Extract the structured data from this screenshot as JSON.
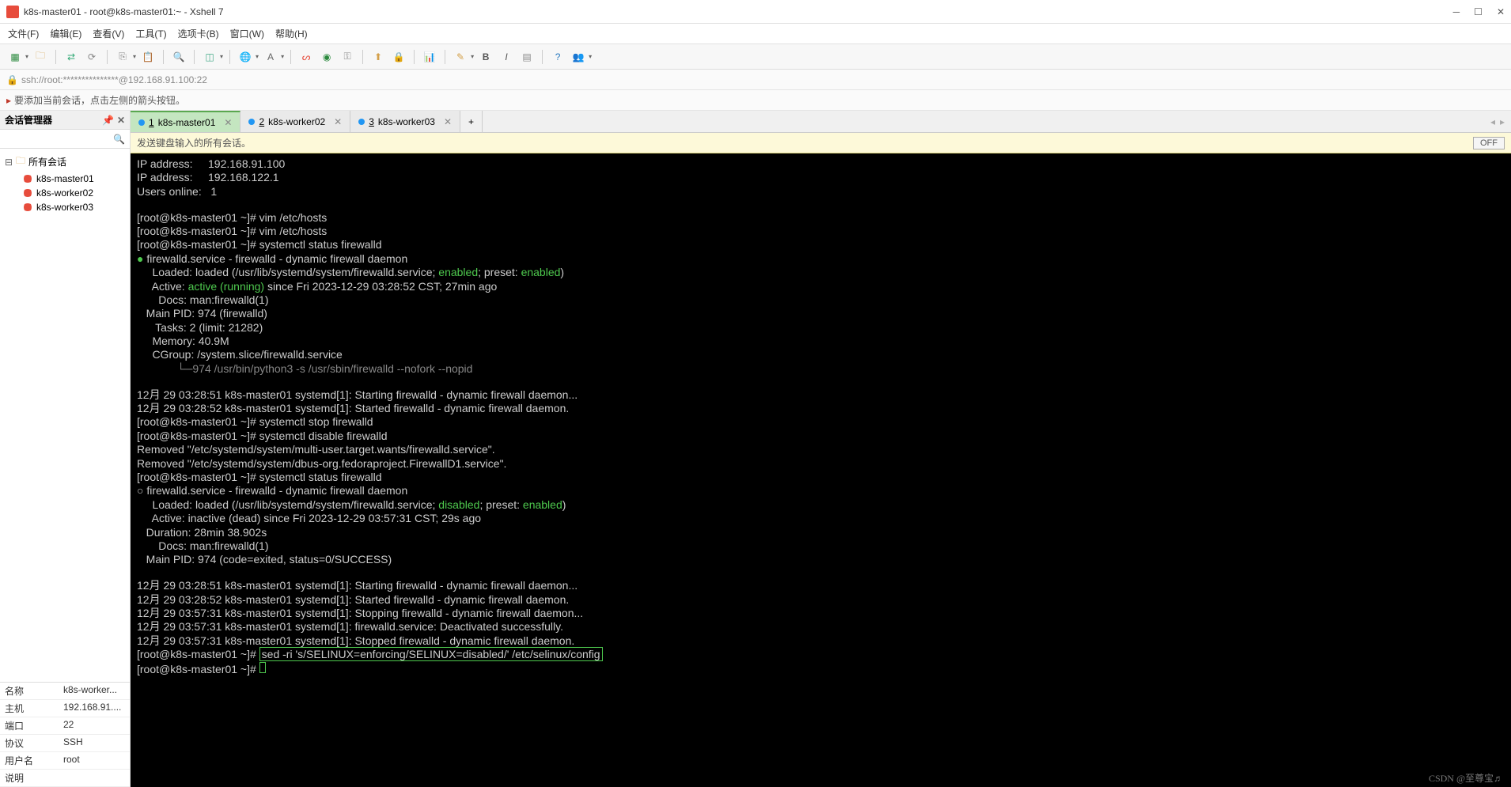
{
  "title": "k8s-master01 - root@k8s-master01:~ - Xshell 7",
  "menu": [
    "文件(F)",
    "编辑(E)",
    "查看(V)",
    "工具(T)",
    "选项卡(B)",
    "窗口(W)",
    "帮助(H)"
  ],
  "address": "ssh://root:***************@192.168.91.100:22",
  "tip": "要添加当前会话，点击左侧的箭头按钮。",
  "sidebar": {
    "header": "会话管理器",
    "root": "所有会话",
    "items": [
      "k8s-master01",
      "k8s-worker02",
      "k8s-worker03"
    ]
  },
  "props": [
    {
      "k": "名称",
      "v": "k8s-worker..."
    },
    {
      "k": "主机",
      "v": "192.168.91...."
    },
    {
      "k": "端口",
      "v": "22"
    },
    {
      "k": "协议",
      "v": "SSH"
    },
    {
      "k": "用户名",
      "v": "root"
    },
    {
      "k": "说明",
      "v": ""
    }
  ],
  "tabs": [
    {
      "num": "1",
      "label": "k8s-master01",
      "active": true
    },
    {
      "num": "2",
      "label": "k8s-worker02",
      "active": false
    },
    {
      "num": "3",
      "label": "k8s-worker03",
      "active": false
    }
  ],
  "broadcast": {
    "text": "发送键盘输入的所有会话。",
    "btn": "OFF"
  },
  "term": {
    "l1": "IP address:     192.168.91.100",
    "l2": "IP address:     192.168.122.1",
    "l3": "Users online:   1",
    "p1": "[root@k8s-master01 ~]# vim /etc/hosts",
    "p2": "[root@k8s-master01 ~]# vim /etc/hosts",
    "p3": "[root@k8s-master01 ~]# systemctl status firewalld",
    "s1a": "firewalld.service - firewalld - dynamic firewall daemon",
    "s1b_pre": "     Loaded: loaded (/usr/lib/systemd/system/firewalld.service; ",
    "s1b_en": "enabled",
    "s1b_mid": "; preset: ",
    "s1b_en2": "enabled",
    "s1b_post": ")",
    "s1c_pre": "     Active: ",
    "s1c_act": "active (running)",
    "s1c_post": " since Fri 2023-12-29 03:28:52 CST; 27min ago",
    "s1d": "       Docs: man:firewalld(1)",
    "s1e": "   Main PID: 974 (firewalld)",
    "s1f": "      Tasks: 2 (limit: 21282)",
    "s1g": "     Memory: 40.9M",
    "s1h": "     CGroup: /system.slice/firewalld.service",
    "s1i": "             └─974 /usr/bin/python3 -s /usr/sbin/firewalld --nofork --nopid",
    "log1": "12月 29 03:28:51 k8s-master01 systemd[1]: Starting firewalld - dynamic firewall daemon...",
    "log2": "12月 29 03:28:52 k8s-master01 systemd[1]: Started firewalld - dynamic firewall daemon.",
    "p4": "[root@k8s-master01 ~]# systemctl stop firewalld",
    "p5": "[root@k8s-master01 ~]# systemctl disable firewalld",
    "rm1": "Removed \"/etc/systemd/system/multi-user.target.wants/firewalld.service\".",
    "rm2": "Removed \"/etc/systemd/system/dbus-org.fedoraproject.FirewallD1.service\".",
    "p6": "[root@k8s-master01 ~]# systemctl status firewalld",
    "s2a": "firewalld.service - firewalld - dynamic firewall daemon",
    "s2b_pre": "     Loaded: loaded (/usr/lib/systemd/system/firewalld.service; ",
    "s2b_dis": "disabled",
    "s2b_mid": "; preset: ",
    "s2b_en": "enabled",
    "s2b_post": ")",
    "s2c": "     Active: inactive (dead) since Fri 2023-12-29 03:57:31 CST; 29s ago",
    "s2d": "   Duration: 28min 38.902s",
    "s2e": "       Docs: man:firewalld(1)",
    "s2f": "   Main PID: 974 (code=exited, status=0/SUCCESS)",
    "log3": "12月 29 03:28:51 k8s-master01 systemd[1]: Starting firewalld - dynamic firewall daemon...",
    "log4": "12月 29 03:28:52 k8s-master01 systemd[1]: Started firewalld - dynamic firewall daemon.",
    "log5": "12月 29 03:57:31 k8s-master01 systemd[1]: Stopping firewalld - dynamic firewall daemon...",
    "log6": "12月 29 03:57:31 k8s-master01 systemd[1]: firewalld.service: Deactivated successfully.",
    "log7": "12月 29 03:57:31 k8s-master01 systemd[1]: Stopped firewalld - dynamic firewall daemon.",
    "p7_pre": "[root@k8s-master01 ~]# ",
    "p7_cmd": "sed -ri 's/SELINUX=enforcing/SELINUX=disabled/' /etc/selinux/config",
    "p8": "[root@k8s-master01 ~]# "
  },
  "watermark": "CSDN @至尊宝♬"
}
